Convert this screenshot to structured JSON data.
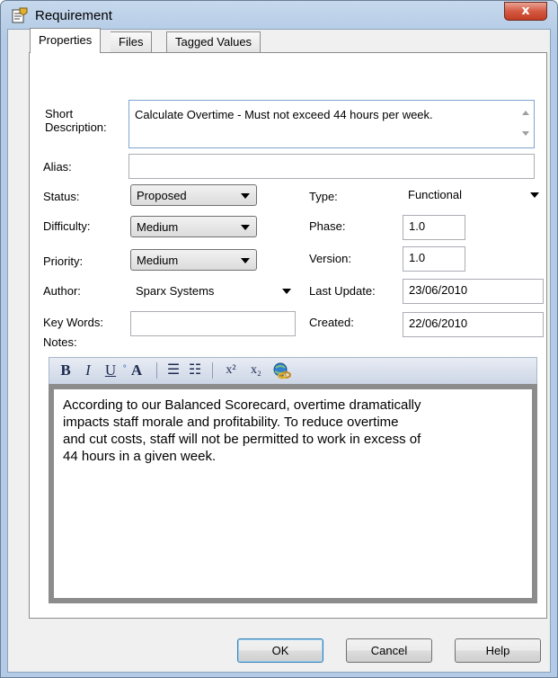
{
  "window": {
    "title": "Requirement",
    "close_label": "x",
    "icon": "requirement-properties-icon"
  },
  "tabs": [
    {
      "label": "Properties",
      "active": true
    },
    {
      "label": "Files",
      "active": false
    },
    {
      "label": "Tagged Values",
      "active": false
    }
  ],
  "form": {
    "short_description": {
      "label_line1": "Short",
      "label_line2": "Description:",
      "value": "Calculate Overtime - Must not exceed 44 hours per week."
    },
    "alias": {
      "label": "Alias:",
      "value": ""
    },
    "status": {
      "label": "Status:",
      "value": "Proposed"
    },
    "type": {
      "label": "Type:",
      "value": "Functional"
    },
    "difficulty": {
      "label": "Difficulty:",
      "value": "Medium"
    },
    "phase": {
      "label": "Phase:",
      "value": "1.0"
    },
    "priority": {
      "label": "Priority:",
      "value": "Medium"
    },
    "version": {
      "label": "Version:",
      "value": "1.0"
    },
    "author": {
      "label": "Author:",
      "value": "Sparx Systems"
    },
    "last_update": {
      "label": "Last Update:",
      "value": "23/06/2010"
    },
    "key_words": {
      "label": "Key Words:",
      "value": ""
    },
    "created": {
      "label": "Created:",
      "value": "22/06/2010"
    }
  },
  "notes": {
    "label": "Notes:",
    "toolbar": {
      "bold": "B",
      "italic": "I",
      "underline": "U",
      "font_color": "A",
      "bullets": "☰",
      "numbering": "☷",
      "superscript": "x²",
      "subscript": "x₂"
    },
    "text": "According to our Balanced Scorecard, overtime dramatically\nimpacts staff morale and profitability.  To reduce overtime\nand cut costs, staff will not be permitted to work in excess of\n44 hours in a given week."
  },
  "buttons": {
    "ok": "OK",
    "cancel": "Cancel",
    "help": "Help"
  },
  "colors": {
    "title_bar": "#b3cbe6",
    "close_button": "#c43c22",
    "toolbar": "#cdd6e6"
  }
}
